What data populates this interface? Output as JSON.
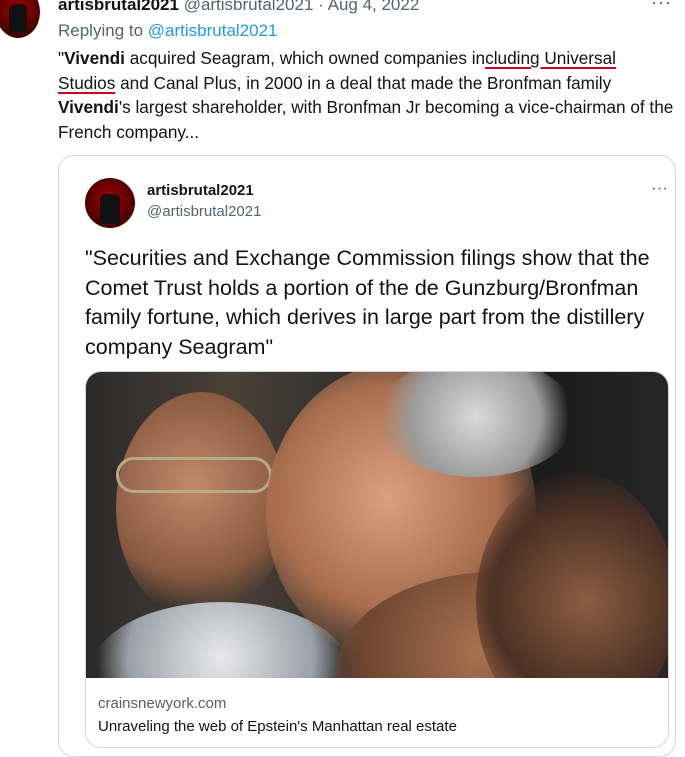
{
  "tweet": {
    "author": "artisbrutal2021",
    "handle": "@artisbrutal2021",
    "separator": "·",
    "date": "Aug 4, 2022",
    "more_icon": "···",
    "replying_prefix": "Replying to ",
    "replying_to": "@artisbrutal2021",
    "body": {
      "open_quote": "\"",
      "bold_1": "Vivendi",
      "t1": " acquired Seagram, which owned companies in",
      "underlined": "cluding Universal Studios",
      "t2": " and Canal Plus, in 2000 in a deal that made the Bronfman family ",
      "bold_2": "Vivendi",
      "t3": "'s largest shareholder, with Bronfman Jr becoming a vice-chairman of the French company..."
    }
  },
  "quote": {
    "author": "artisbrutal2021",
    "handle": "@artisbrutal2021",
    "more_icon": "···",
    "text": "\"Securities and Exchange Commission filings show that the Comet Trust holds a portion of the de Gunzburg/Bronfman family fortune, which derives in large part from the distillery company Seagram\"",
    "link": {
      "domain": "crainsnewyork.com",
      "title": "Unraveling the web of Epstein's Manhattan real estate"
    }
  },
  "colors": {
    "link": "#1d9bf0",
    "muted": "#536471",
    "underline": "#d0021b",
    "border": "#cfd9de"
  }
}
